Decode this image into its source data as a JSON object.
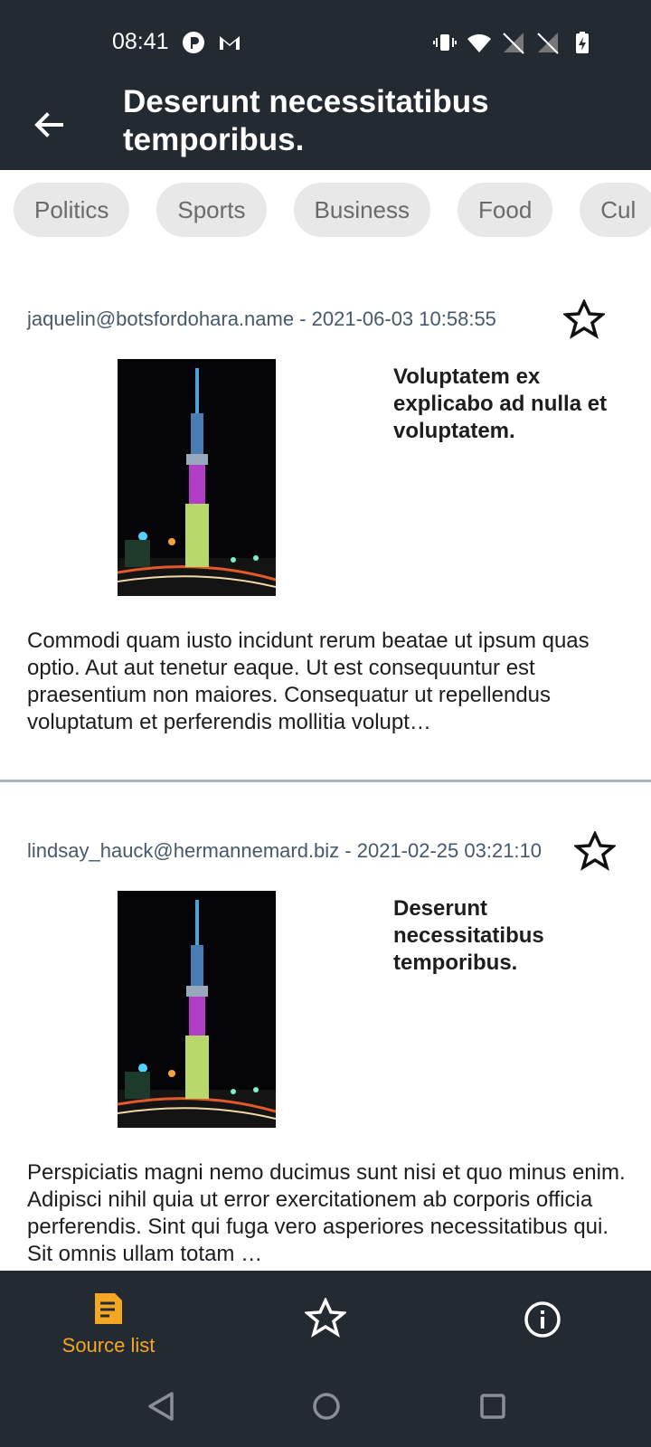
{
  "status": {
    "time": "08:41"
  },
  "app_bar": {
    "title": "Deserunt necessitatibus temporibus."
  },
  "categories": [
    "Politics",
    "Sports",
    "Business",
    "Food",
    "Cul"
  ],
  "articles": [
    {
      "meta": "jaquelin@botsfordohara.name - 2021-06-03 10:58:55",
      "title": "Voluptatem ex explicabo ad nulla et voluptatem.",
      "body": "Commodi quam iusto incidunt rerum beatae ut ipsum quas optio. Aut aut tenetur eaque. Ut est consequuntur est praesentium non maiores. Consequatur ut repellendus voluptatum et perferendis mollitia volupt…"
    },
    {
      "meta": "lindsay_hauck@hermannemard.biz - 2021-02-25 03:21:10",
      "title": "Deserunt necessitatibus temporibus.",
      "body": "Perspiciatis magni nemo ducimus sunt nisi et quo minus enim. Adipisci nihil quia ut error exercitationem ab corporis officia perferendis. Sint qui fuga vero asperiores necessitatibus qui. Sit omnis ullam totam …"
    }
  ],
  "bottom_nav": {
    "source_list_label": "Source list"
  },
  "colors": {
    "bar": "#232a31",
    "accent": "#f5a623",
    "meta": "#46596a"
  }
}
